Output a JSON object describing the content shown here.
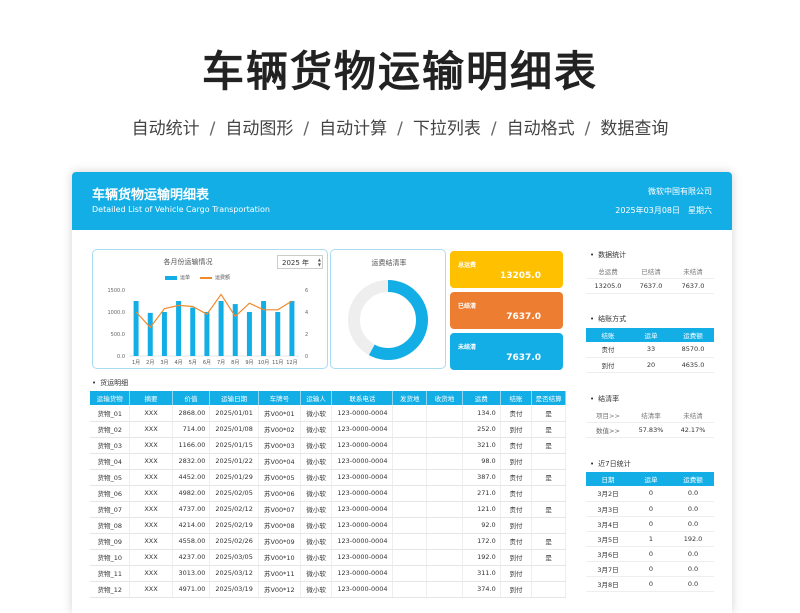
{
  "hero": {
    "title": "车辆货物运输明细表",
    "features": [
      "自动统计",
      "自动图形",
      "自动计算",
      "下拉列表",
      "自动格式",
      "数据查询"
    ]
  },
  "header": {
    "title": "车辆货物运输明细表",
    "subtitle": "Detailed List of Vehicle Cargo Transportation",
    "company": "微软中国有限公司",
    "date": "2025年03月08日",
    "weekday": "星期六"
  },
  "chart": {
    "title": "各月份运输情况",
    "year": "2025 年",
    "legend_bar": "运单",
    "legend_line": "运费额"
  },
  "chart_data": {
    "type": "bar",
    "categories": [
      "1月",
      "2月",
      "3月",
      "4月",
      "5月",
      "6月",
      "7月",
      "8月",
      "9月",
      "10月",
      "11月",
      "12月"
    ],
    "series": [
      {
        "name": "运单",
        "axis": "left",
        "type": "bar",
        "values": [
          1250,
          980,
          1000,
          1250,
          1100,
          1000,
          1250,
          1180,
          1000,
          1250,
          1000,
          1250
        ]
      },
      {
        "name": "运费额",
        "axis": "right",
        "type": "line",
        "values": [
          4.0,
          2.6,
          4.3,
          4.6,
          4.5,
          3.8,
          5.6,
          3.6,
          4.8,
          4.2,
          4.2,
          5.0
        ]
      }
    ],
    "yticks_left": [
      "1500.0",
      "1000.0",
      "500.0",
      "0.0"
    ],
    "yticks_right": [
      "6",
      "4",
      "2",
      "0"
    ],
    "ylim_left": [
      0,
      1500
    ],
    "ylim_right": [
      0,
      6
    ],
    "colors": {
      "bar": "#14aee6",
      "line": "#f08a2b"
    }
  },
  "ring": {
    "title": "运费结清率",
    "fraction": 0.5783,
    "colors": {
      "filled": "#14aee6",
      "track": "#eeeeee"
    }
  },
  "stats": [
    {
      "label": "总运费",
      "value": "13205.0"
    },
    {
      "label": "已结清",
      "value": "7637.0"
    },
    {
      "label": "未结清",
      "value": "7637.0"
    }
  ],
  "detail": {
    "section_label": "货运明细",
    "columns": [
      "运输货物",
      "摘要",
      "价值",
      "运输日期",
      "车牌号",
      "运输人",
      "联系电话",
      "发货地",
      "收货地",
      "运费",
      "结账",
      "是否结算"
    ],
    "rows": [
      [
        "货物_01",
        "XXX",
        "2868.00",
        "2025/01/01",
        "苏V00*01",
        "微小软",
        "123-0000-0004",
        "",
        "",
        "134.0",
        "责付",
        "是"
      ],
      [
        "货物_02",
        "XXX",
        "714.00",
        "2025/01/08",
        "苏V00*02",
        "微小软",
        "123-0000-0004",
        "",
        "",
        "252.0",
        "到付",
        "是"
      ],
      [
        "货物_03",
        "XXX",
        "1166.00",
        "2025/01/15",
        "苏V00*03",
        "微小软",
        "123-0000-0004",
        "",
        "",
        "321.0",
        "责付",
        "是"
      ],
      [
        "货物_04",
        "XXX",
        "2832.00",
        "2025/01/22",
        "苏V00*04",
        "微小软",
        "123-0000-0004",
        "",
        "",
        "98.0",
        "到付",
        ""
      ],
      [
        "货物_05",
        "XXX",
        "4452.00",
        "2025/01/29",
        "苏V00*05",
        "微小软",
        "123-0000-0004",
        "",
        "",
        "387.0",
        "责付",
        "是"
      ],
      [
        "货物_06",
        "XXX",
        "4982.00",
        "2025/02/05",
        "苏V00*06",
        "微小软",
        "123-0000-0004",
        "",
        "",
        "271.0",
        "责付",
        ""
      ],
      [
        "货物_07",
        "XXX",
        "4737.00",
        "2025/02/12",
        "苏V00*07",
        "微小软",
        "123-0000-0004",
        "",
        "",
        "121.0",
        "责付",
        "是"
      ],
      [
        "货物_08",
        "XXX",
        "4214.00",
        "2025/02/19",
        "苏V00*08",
        "微小软",
        "123-0000-0004",
        "",
        "",
        "92.0",
        "到付",
        ""
      ],
      [
        "货物_09",
        "XXX",
        "4558.00",
        "2025/02/26",
        "苏V00*09",
        "微小软",
        "123-0000-0004",
        "",
        "",
        "172.0",
        "责付",
        "是"
      ],
      [
        "货物_10",
        "XXX",
        "4237.00",
        "2025/03/05",
        "苏V00*10",
        "微小软",
        "123-0000-0004",
        "",
        "",
        "192.0",
        "到付",
        "是"
      ],
      [
        "货物_11",
        "XXX",
        "3013.00",
        "2025/03/12",
        "苏V00*11",
        "微小软",
        "123-0000-0004",
        "",
        "",
        "311.0",
        "到付",
        ""
      ],
      [
        "货物_12",
        "XXX",
        "4971.00",
        "2025/03/19",
        "苏V00*12",
        "微小软",
        "123-0000-0004",
        "",
        "",
        "374.0",
        "到付",
        ""
      ]
    ]
  },
  "right": {
    "data_stats": {
      "label": "数据统计",
      "headers": [
        "总运费",
        "已结清",
        "未结清"
      ],
      "values": [
        "13205.0",
        "7637.0",
        "7637.0"
      ]
    },
    "settle_method": {
      "label": "结账方式",
      "headers": [
        "结账",
        "运单",
        "运费额"
      ],
      "rows": [
        [
          "责付",
          "33",
          "8570.0"
        ],
        [
          "到付",
          "20",
          "4635.0"
        ]
      ]
    },
    "settle_rate": {
      "label": "结清率",
      "headers": [
        "项目>>",
        "结清率",
        "未结清"
      ],
      "row": [
        "数值>>",
        "57.83%",
        "42.17%"
      ]
    },
    "recent7": {
      "label": "近7日统计",
      "headers": [
        "日期",
        "运单",
        "运费额"
      ],
      "rows": [
        [
          "3月2日",
          "0",
          "0.0"
        ],
        [
          "3月3日",
          "0",
          "0.0"
        ],
        [
          "3月4日",
          "0",
          "0.0"
        ],
        [
          "3月5日",
          "1",
          "192.0"
        ],
        [
          "3月6日",
          "0",
          "0.0"
        ],
        [
          "3月7日",
          "0",
          "0.0"
        ],
        [
          "3月8日",
          "0",
          "0.0"
        ]
      ]
    }
  }
}
